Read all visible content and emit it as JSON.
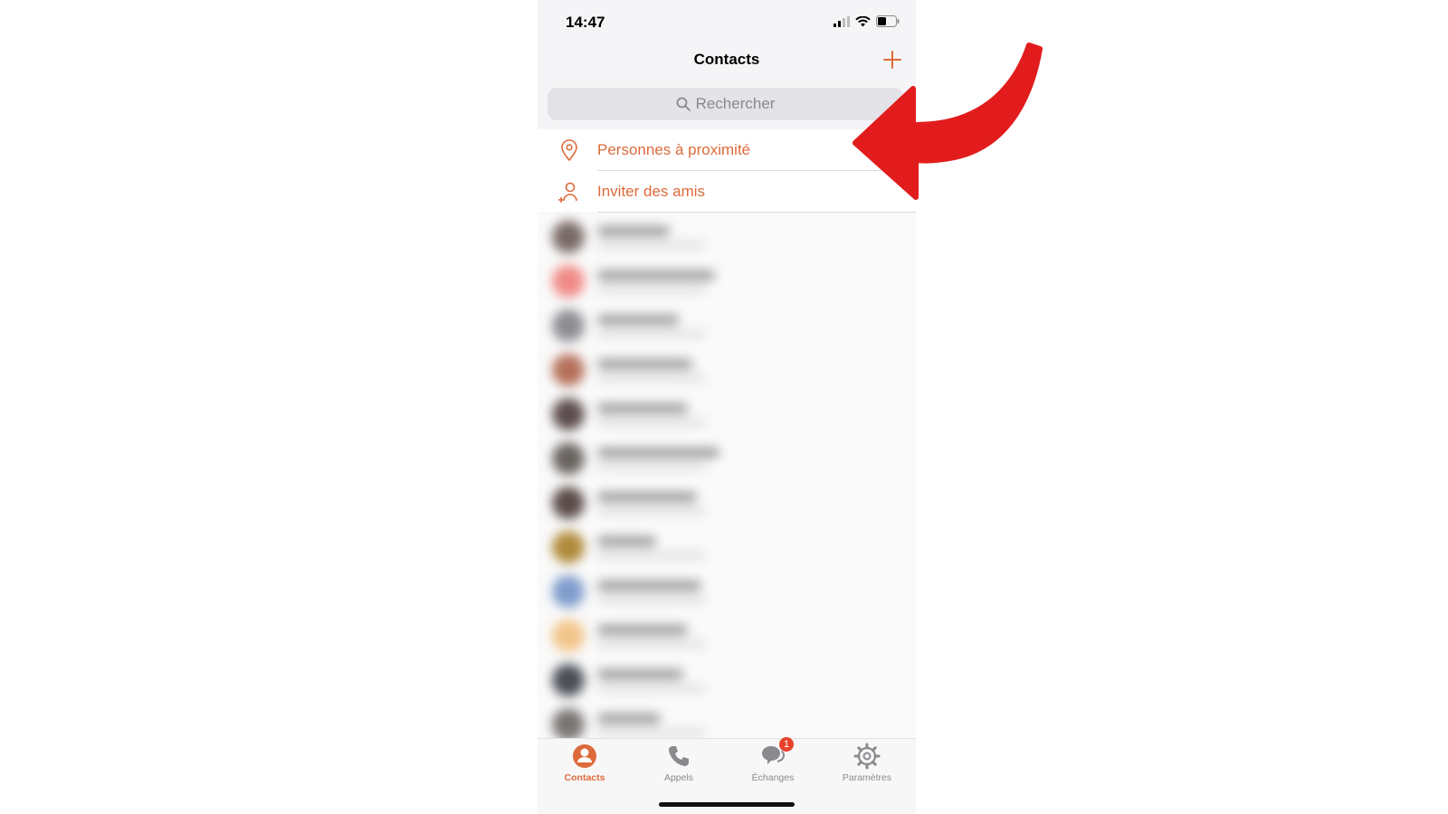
{
  "status_bar": {
    "time": "14:47"
  },
  "nav": {
    "title": "Contacts"
  },
  "search": {
    "placeholder": "Rechercher"
  },
  "menu": [
    {
      "label": "Personnes à proximité",
      "icon": "location-pin-icon"
    },
    {
      "label": "Inviter des amis",
      "icon": "add-person-icon"
    }
  ],
  "contacts_note": "blurred",
  "tabs": [
    {
      "label": "Contacts",
      "icon": "person-circle-icon",
      "active": true
    },
    {
      "label": "Appels",
      "icon": "phone-icon",
      "active": false
    },
    {
      "label": "Échanges",
      "icon": "chat-bubbles-icon",
      "active": false,
      "badge": "1"
    },
    {
      "label": "Paramètres",
      "icon": "gear-icon",
      "active": false
    }
  ],
  "colors": {
    "accent": "#dd6a3a",
    "arrow": "#e21c1c",
    "badge": "#e8422c"
  }
}
